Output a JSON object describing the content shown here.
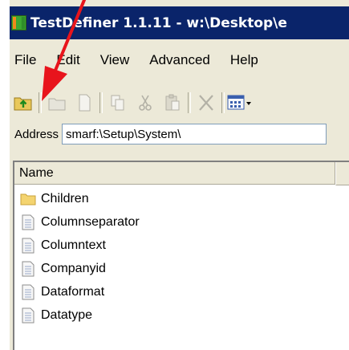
{
  "window": {
    "title": "TestDefiner 1.1.11 - w:\\Desktop\\e"
  },
  "menu": [
    "File",
    "Edit",
    "View",
    "Advanced",
    "Help"
  ],
  "toolbar": {
    "buttons": [
      "up-folder-icon",
      "folder-icon",
      "new-document-icon",
      "copy-icon",
      "cut-icon",
      "paste-icon",
      "delete-icon",
      "view-menu-icon"
    ]
  },
  "address": {
    "label": "Address",
    "value": "smarf:\\Setup\\System\\"
  },
  "list": {
    "header": "Name",
    "items": [
      {
        "name": "Children",
        "icon": "folder-icon"
      },
      {
        "name": "Columnseparator",
        "icon": "document-icon"
      },
      {
        "name": "Columntext",
        "icon": "document-icon"
      },
      {
        "name": "Companyid",
        "icon": "document-icon"
      },
      {
        "name": "Dataformat",
        "icon": "document-icon"
      },
      {
        "name": "Datatype",
        "icon": "document-icon"
      }
    ]
  },
  "colors": {
    "title_bar": "#0a246a",
    "annotation_arrow": "#e8141c"
  }
}
